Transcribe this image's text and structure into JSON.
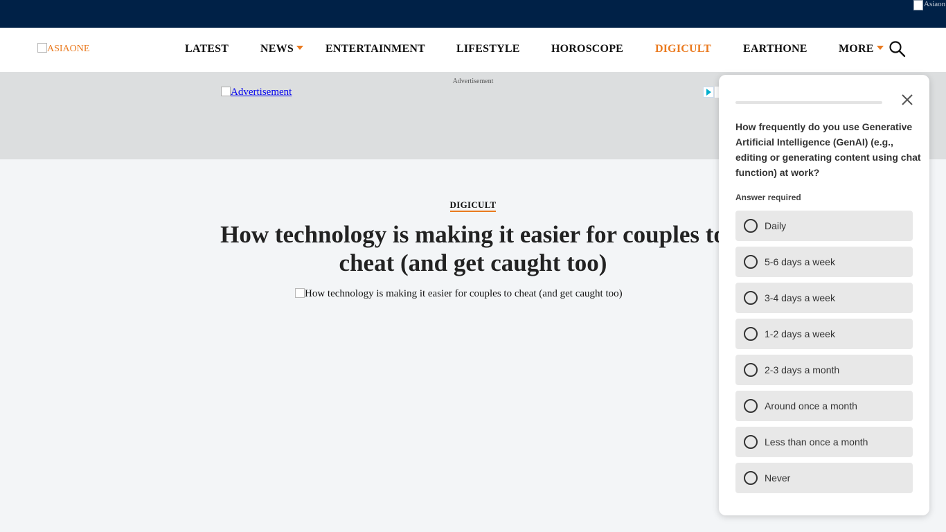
{
  "topbar": {
    "broken_image_alt": "Asiaon"
  },
  "header": {
    "logo_alt": "ASIAONE",
    "nav": [
      {
        "label": "LATEST",
        "has_dropdown": false,
        "active": false
      },
      {
        "label": "NEWS",
        "has_dropdown": true,
        "active": false
      },
      {
        "label": "ENTERTAINMENT",
        "has_dropdown": false,
        "active": false
      },
      {
        "label": "LIFESTYLE",
        "has_dropdown": false,
        "active": false
      },
      {
        "label": "HOROSCOPE",
        "has_dropdown": false,
        "active": false
      },
      {
        "label": "DIGICULT",
        "has_dropdown": false,
        "active": true
      },
      {
        "label": "EARTHONE",
        "has_dropdown": false,
        "active": false
      },
      {
        "label": "MORE",
        "has_dropdown": true,
        "active": false
      }
    ],
    "search_icon": "search-icon"
  },
  "ad": {
    "label": "Advertisement",
    "link_alt": "Advertisement"
  },
  "article": {
    "category": "DIGICULT",
    "title": "How technology is making it easier for couples to cheat (and get caught too)",
    "hero_image_alt": "How technology is making it easier for couples to cheat (and get caught too)"
  },
  "survey": {
    "question": "How frequently do you use Generative Artificial Intelligence (GenAI) (e.g., editing or generating content using chat function) at work?",
    "required_text": "Answer required",
    "options": [
      {
        "label": "Daily"
      },
      {
        "label": "5-6 days a week"
      },
      {
        "label": "3-4 days a week"
      },
      {
        "label": "1-2 days a week"
      },
      {
        "label": "2-3 days a month"
      },
      {
        "label": "Around once a month"
      },
      {
        "label": "Less than once a month"
      },
      {
        "label": "Never"
      }
    ],
    "close_icon": "close-icon"
  },
  "colors": {
    "topbar": "#002147",
    "accent": "#ea7a1f",
    "page_bg": "#f3f5f7",
    "ad_bg": "#dcdedf",
    "option_bg": "#e8e8e8"
  }
}
